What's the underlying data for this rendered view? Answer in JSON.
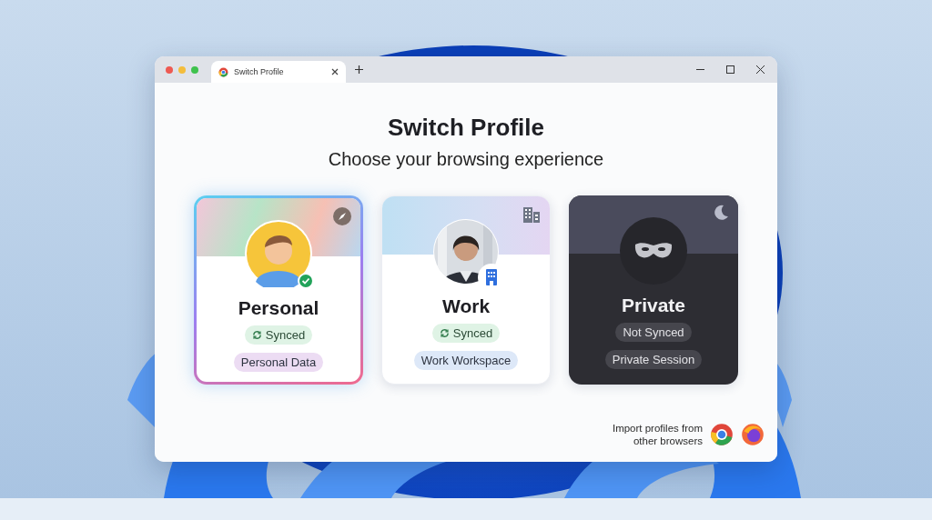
{
  "window": {
    "tab": {
      "title": "Switch Profile",
      "selected": true
    }
  },
  "heading": "Switch Profile",
  "subheading": "Choose your browsing experience",
  "profiles": [
    {
      "kind": "personal",
      "name": "Personal",
      "selected": true,
      "sync": {
        "label": "Synced",
        "synced": true
      },
      "tag": "Personal Data"
    },
    {
      "kind": "work",
      "name": "Work",
      "selected": false,
      "sync": {
        "label": "Synced",
        "synced": true
      },
      "tag": "Work Workspace"
    },
    {
      "kind": "private",
      "name": "Private",
      "selected": false,
      "sync": {
        "label": "Not Synced",
        "synced": false
      },
      "tag": "Private Session"
    }
  ],
  "import": {
    "label": "Import profiles from other browsers"
  }
}
